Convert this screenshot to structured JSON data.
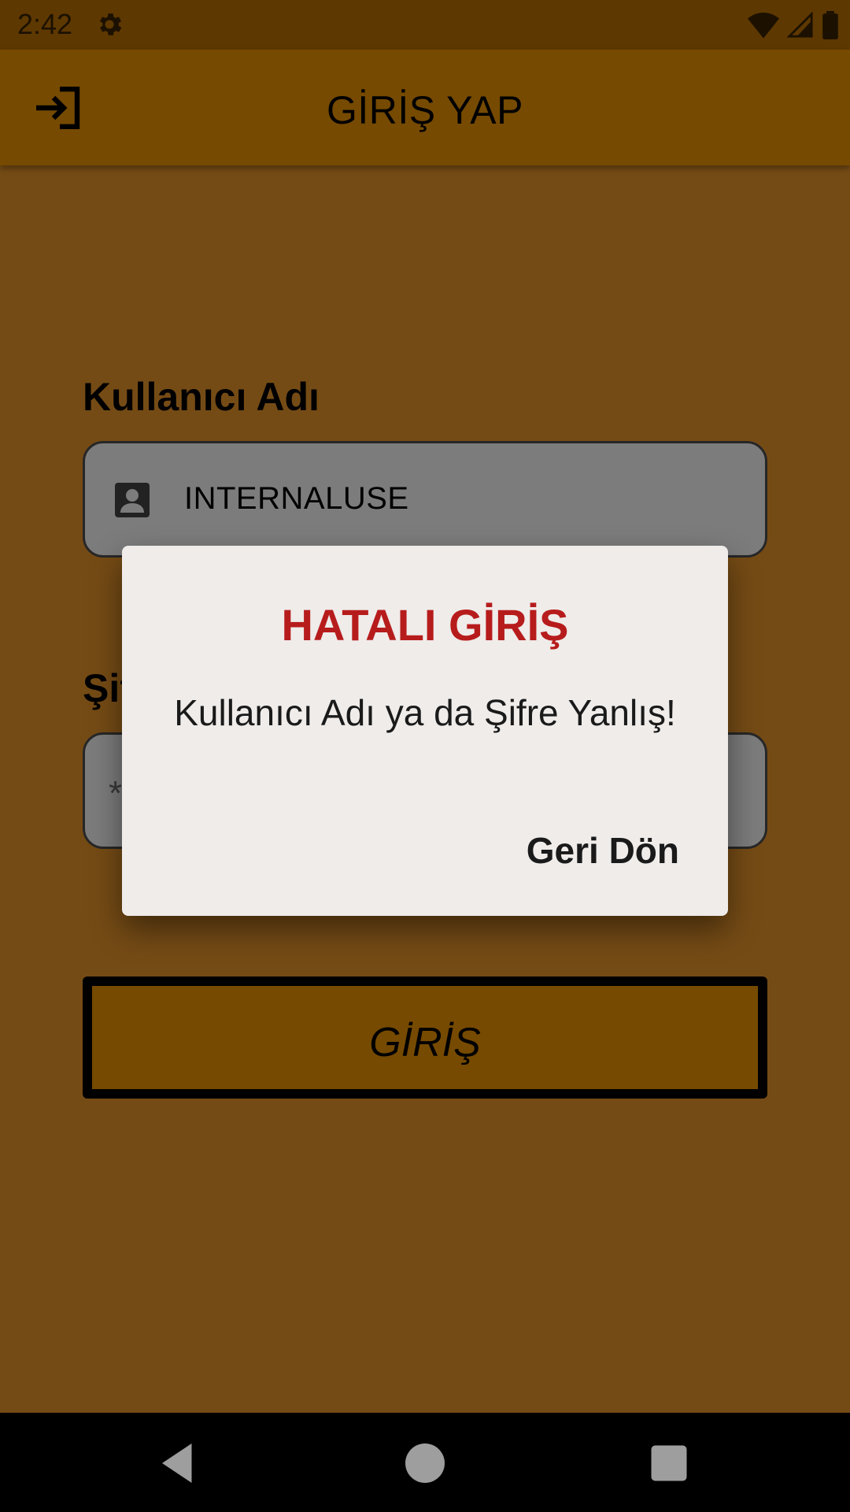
{
  "status_bar": {
    "time": "2:42",
    "icons": [
      "settings-icon",
      "wifi-icon",
      "signal-icon",
      "battery-icon"
    ]
  },
  "app_bar": {
    "title": "GİRİŞ YAP",
    "icon": "login-icon"
  },
  "form": {
    "username_label": "Kullanıcı Adı",
    "username_value": "INTERNALUSE",
    "password_label": "Şifre",
    "password_mask": "*",
    "login_button_label": "GİRİŞ"
  },
  "dialog": {
    "title": "HATALI GİRİŞ",
    "message": "Kullanıcı Adı ya da Şifre Yanlış!",
    "action_label": "Geri Dön"
  },
  "colors": {
    "app_background": "#ad6f1f",
    "app_bar": "#ae6e00",
    "dialog_title": "#b71c1c",
    "dialog_background": "#efecea"
  },
  "nav_bar": {
    "icons": [
      "back-icon",
      "home-icon",
      "recents-icon"
    ]
  }
}
